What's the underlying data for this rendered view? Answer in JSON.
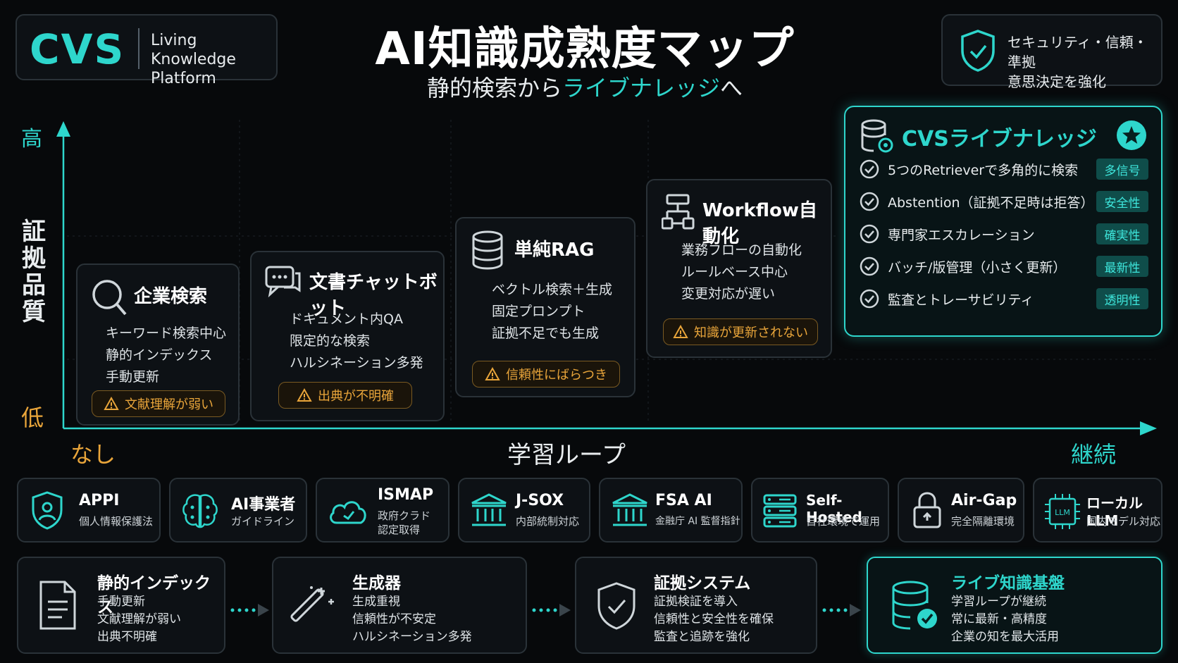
{
  "header": {
    "logo": "CVS",
    "logo_sub_line1": "Living Knowledge",
    "logo_sub_line2": "Platform",
    "title": "AI知識成熟度マップ",
    "subtitle_prefix": "静的検索から",
    "subtitle_highlight": "ライブナレッジ",
    "subtitle_suffix": "へ",
    "security_line1": "セキュリティ・信頼・準拠",
    "security_line2": "意思決定を強化"
  },
  "axes": {
    "y_label": "証拠品質",
    "y_high": "高",
    "y_low": "低",
    "x_label": "学習ループ",
    "x_start": "なし",
    "x_end": "継続"
  },
  "stages": [
    {
      "title": "企業検索",
      "icon": "search-icon",
      "items": [
        "キーワード検索中心",
        "静的インデックス",
        "手動更新"
      ],
      "warning": "文献理解が弱い"
    },
    {
      "title": "文書チャットボット",
      "icon": "chat-icon",
      "items": [
        "ドキュメント内QA",
        "限定的な検索",
        "ハルシネーション多発"
      ],
      "warning": "出典が不明確"
    },
    {
      "title": "単純RAG",
      "icon": "database-icon",
      "items": [
        "ベクトル検索＋生成",
        "固定プロンプト",
        "証拠不足でも生成"
      ],
      "warning": "信頼性にばらつき"
    },
    {
      "title": "Workflow自動化",
      "icon": "workflow-icon",
      "items": [
        "業務フローの自動化",
        "ルールベース中心",
        "変更対応が遅い"
      ],
      "warning": "知識が更新されない"
    }
  ],
  "cvs_live": {
    "title": "CVSライブナレッジ",
    "rows": [
      {
        "label": "5つのRetrieverで多角的に検索",
        "tag": "多信号"
      },
      {
        "label": "Abstention（証拠不足時は拒答）",
        "tag": "安全性"
      },
      {
        "label": "専門家エスカレーション",
        "tag": "確実性"
      },
      {
        "label": "バッチ/版管理（小さく更新）",
        "tag": "最新性"
      },
      {
        "label": "監査とトレーサビリティ",
        "tag": "透明性"
      }
    ]
  },
  "compliance": [
    {
      "title": "APPI",
      "sub": "個人情報保護法",
      "icon": "shield-user-icon"
    },
    {
      "title": "AI事業者",
      "sub": "ガイドライン",
      "icon": "brain-icon"
    },
    {
      "title": "ISMAP",
      "sub": "政府クラウド認定取得",
      "sub1": "政府クラド",
      "sub2": "認定取得",
      "icon": "cloud-icon"
    },
    {
      "title": "J-SOX",
      "sub": "内部統制対応",
      "icon": "bank-icon"
    },
    {
      "title": "FSA AI",
      "sub": "金融庁 AI 監督指針",
      "icon": "bank-icon"
    },
    {
      "title": "Self-Hosted",
      "sub": "自社環境で運用",
      "icon": "server-icon"
    },
    {
      "title": "Air-Gap",
      "sub": "完全隔離環境",
      "icon": "lock-icon"
    },
    {
      "title": "ローカルLLM",
      "sub": "国内モデル対応",
      "icon": "chip-icon"
    }
  ],
  "evolution": [
    {
      "title": "静的インデックス",
      "items": [
        "手動更新",
        "文献理解が弱い",
        "出典不明確"
      ],
      "icon": "document-icon"
    },
    {
      "title": "生成器",
      "items": [
        "生成重視",
        "信頼性が不安定",
        "ハルシネーション多発"
      ],
      "icon": "magic-wand-icon"
    },
    {
      "title": "証拠システム",
      "items": [
        "証拠検証を導入",
        "信頼性と安全性を確保",
        "監査と追跡を強化"
      ],
      "icon": "shield-check-icon"
    },
    {
      "title": "ライブ知識基盤",
      "items": [
        "学習ループが継続",
        "常に最新・高精度",
        "企業の知を最大活用"
      ],
      "icon": "database-check-icon"
    }
  ],
  "colors": {
    "accent": "#2ed6cc",
    "warning": "#e9a53a",
    "background": "#07090b"
  }
}
